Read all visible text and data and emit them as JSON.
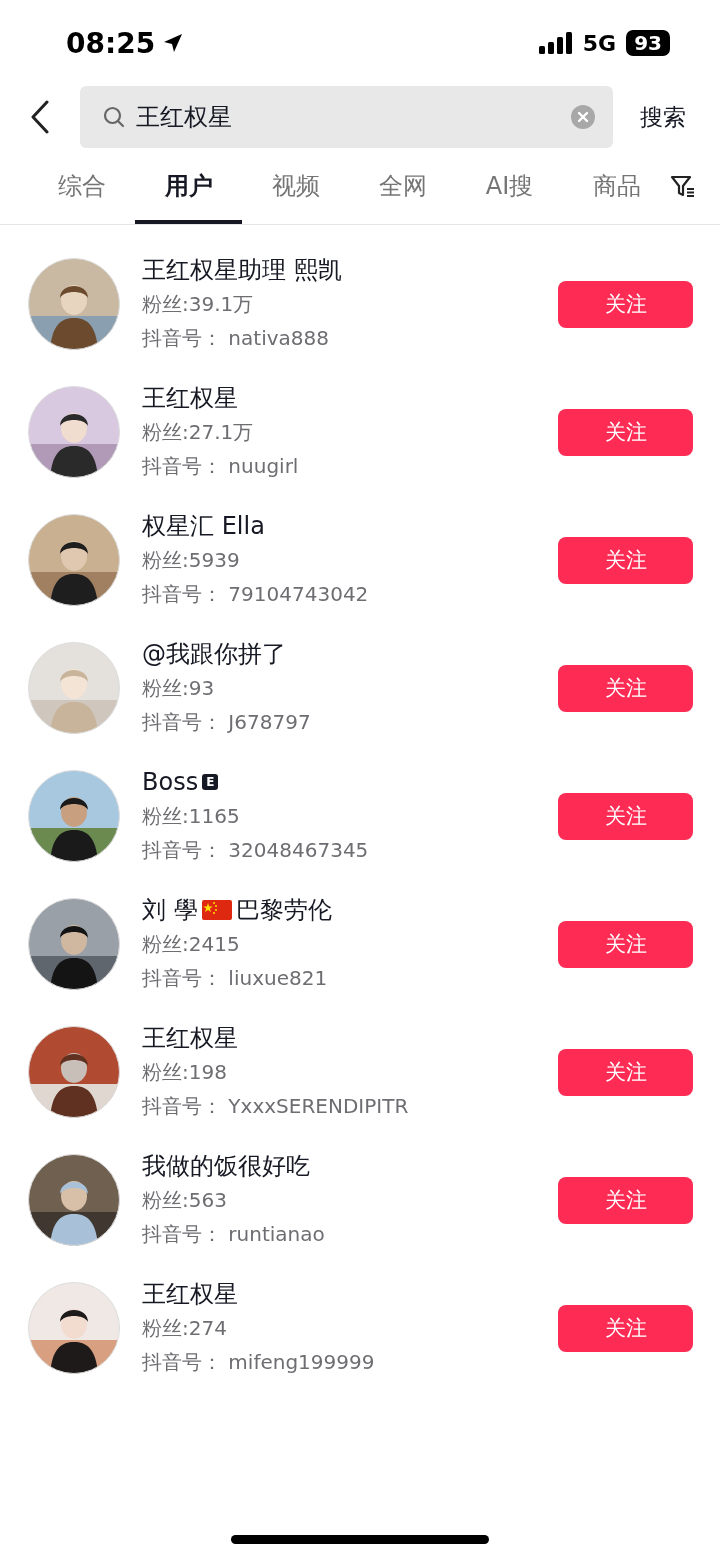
{
  "status_bar": {
    "time": "08:25",
    "network": "5G",
    "battery": "93"
  },
  "search": {
    "value": "王红权星",
    "submit": "搜索"
  },
  "tabs": [
    {
      "label": "综合",
      "selected": false
    },
    {
      "label": "用户",
      "selected": true
    },
    {
      "label": "视频",
      "selected": false
    },
    {
      "label": "全网",
      "selected": false
    },
    {
      "label": "AI搜",
      "selected": false
    },
    {
      "label": "商品",
      "selected": false
    }
  ],
  "users": [
    {
      "name": "王红权星助理 熙凯",
      "fans": "粉丝:39.1万",
      "douyin_id": "抖音号： nativa888",
      "action": "关注"
    },
    {
      "name": "王红权星",
      "fans": "粉丝:27.1万",
      "douyin_id": "抖音号： nuugirl",
      "action": "关注"
    },
    {
      "name": "权星汇 Ella",
      "fans": "粉丝:5939",
      "douyin_id": "抖音号： 79104743042",
      "action": "关注"
    },
    {
      "name": "@我跟你拼了",
      "fans": "粉丝:93",
      "douyin_id": "抖音号： J678797",
      "action": "关注"
    },
    {
      "name": "Boss",
      "badge": "E",
      "fans": "粉丝:1165",
      "douyin_id": "抖音号： 32048467345",
      "action": "关注"
    },
    {
      "name": "刘 學",
      "flag_icon": true,
      "name_suffix": "巴黎劳伦",
      "fans": "粉丝:2415",
      "douyin_id": "抖音号： liuxue821",
      "action": "关注"
    },
    {
      "name": "王红权星",
      "fans": "粉丝:198",
      "douyin_id": "抖音号： YxxxSERENDIPITR",
      "action": "关注"
    },
    {
      "name": "我做的饭很好吃",
      "fans": "粉丝:563",
      "douyin_id": "抖音号： runtianao",
      "action": "关注"
    },
    {
      "name": "王红权星",
      "fans": "粉丝:274",
      "douyin_id": "抖音号： mifeng199999",
      "action": "关注"
    }
  ]
}
